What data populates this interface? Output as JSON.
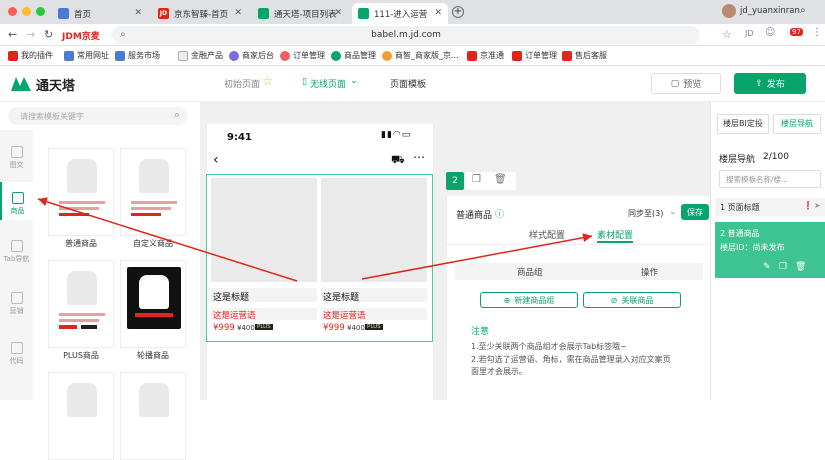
{
  "tabs": [
    {
      "label": "首页",
      "icon": "home-icon"
    },
    {
      "label": "京东智臻-首页",
      "icon": "jd-icon"
    },
    {
      "label": "通天塔-项目列表",
      "icon": "tongtianta-icon"
    },
    {
      "label": "111-进入运营",
      "icon": "tongtianta-icon"
    }
  ],
  "user": "jd_yuanxinran",
  "address": {
    "site": "JDM京麦",
    "url": "babel.m.jd.com",
    "badge": "97"
  },
  "bookmarks": [
    "我的插件",
    "常用网址",
    "服务市场",
    "金融产品",
    "商家后台",
    "订单管理",
    "商品管理",
    "商智_商家版_京...",
    "京准通",
    "订单管理",
    "售后客服"
  ],
  "header": {
    "logo": "通天塔",
    "mode": "初始页面",
    "mode_icon": "star-icon",
    "wireless": "无线页面",
    "template": "页面模板",
    "preview": "预览",
    "publish": "发布"
  },
  "left": {
    "search_placeholder": "请搜索模板关键字",
    "nav": [
      "图文",
      "商品",
      "Tab导航",
      "营销",
      "代码"
    ],
    "templates": [
      {
        "name": "普通商品"
      },
      {
        "name": "自定义商品"
      },
      {
        "name": "PLUS商品"
      },
      {
        "name": "轮播商品"
      }
    ]
  },
  "phone": {
    "time": "9:41",
    "products": [
      {
        "title": "这是标题",
        "slogan": "这是运营语",
        "price": "¥999",
        "orig": "¥400",
        "tag": "PLUS"
      },
      {
        "title": "这是标题",
        "slogan": "这是运营语",
        "price": "¥999",
        "orig": "¥400",
        "tag": "PLUS"
      }
    ]
  },
  "floor_badge": "2",
  "config": {
    "title": "普通商品",
    "sync": "同步至(3)",
    "save": "保存",
    "tabs": [
      "样式配置",
      "素材配置"
    ],
    "table_headers": [
      "商品组",
      "操作"
    ],
    "new_group": "新建商品组",
    "link_product": "关联商品",
    "note_title": "注意",
    "notes": [
      "1.至少关联两个商品组才会展示Tab标签哦~",
      "2.若勾选了运营语、角标，需在商品管理录入对应文案页面里才会展示。"
    ]
  },
  "right": {
    "tabs": [
      "楼层BI定投",
      "楼层导航"
    ],
    "nav_title": "楼层导航",
    "nav_count": "2/100",
    "search_placeholder": "搜索模板名称/楼...",
    "floors": [
      {
        "name": "1 页面标题"
      },
      {
        "name": "2 普通商品",
        "sub": "楼层ID：尚未发布"
      }
    ]
  },
  "colors": {
    "accent": "#09a36c",
    "red": "#e1251b"
  }
}
